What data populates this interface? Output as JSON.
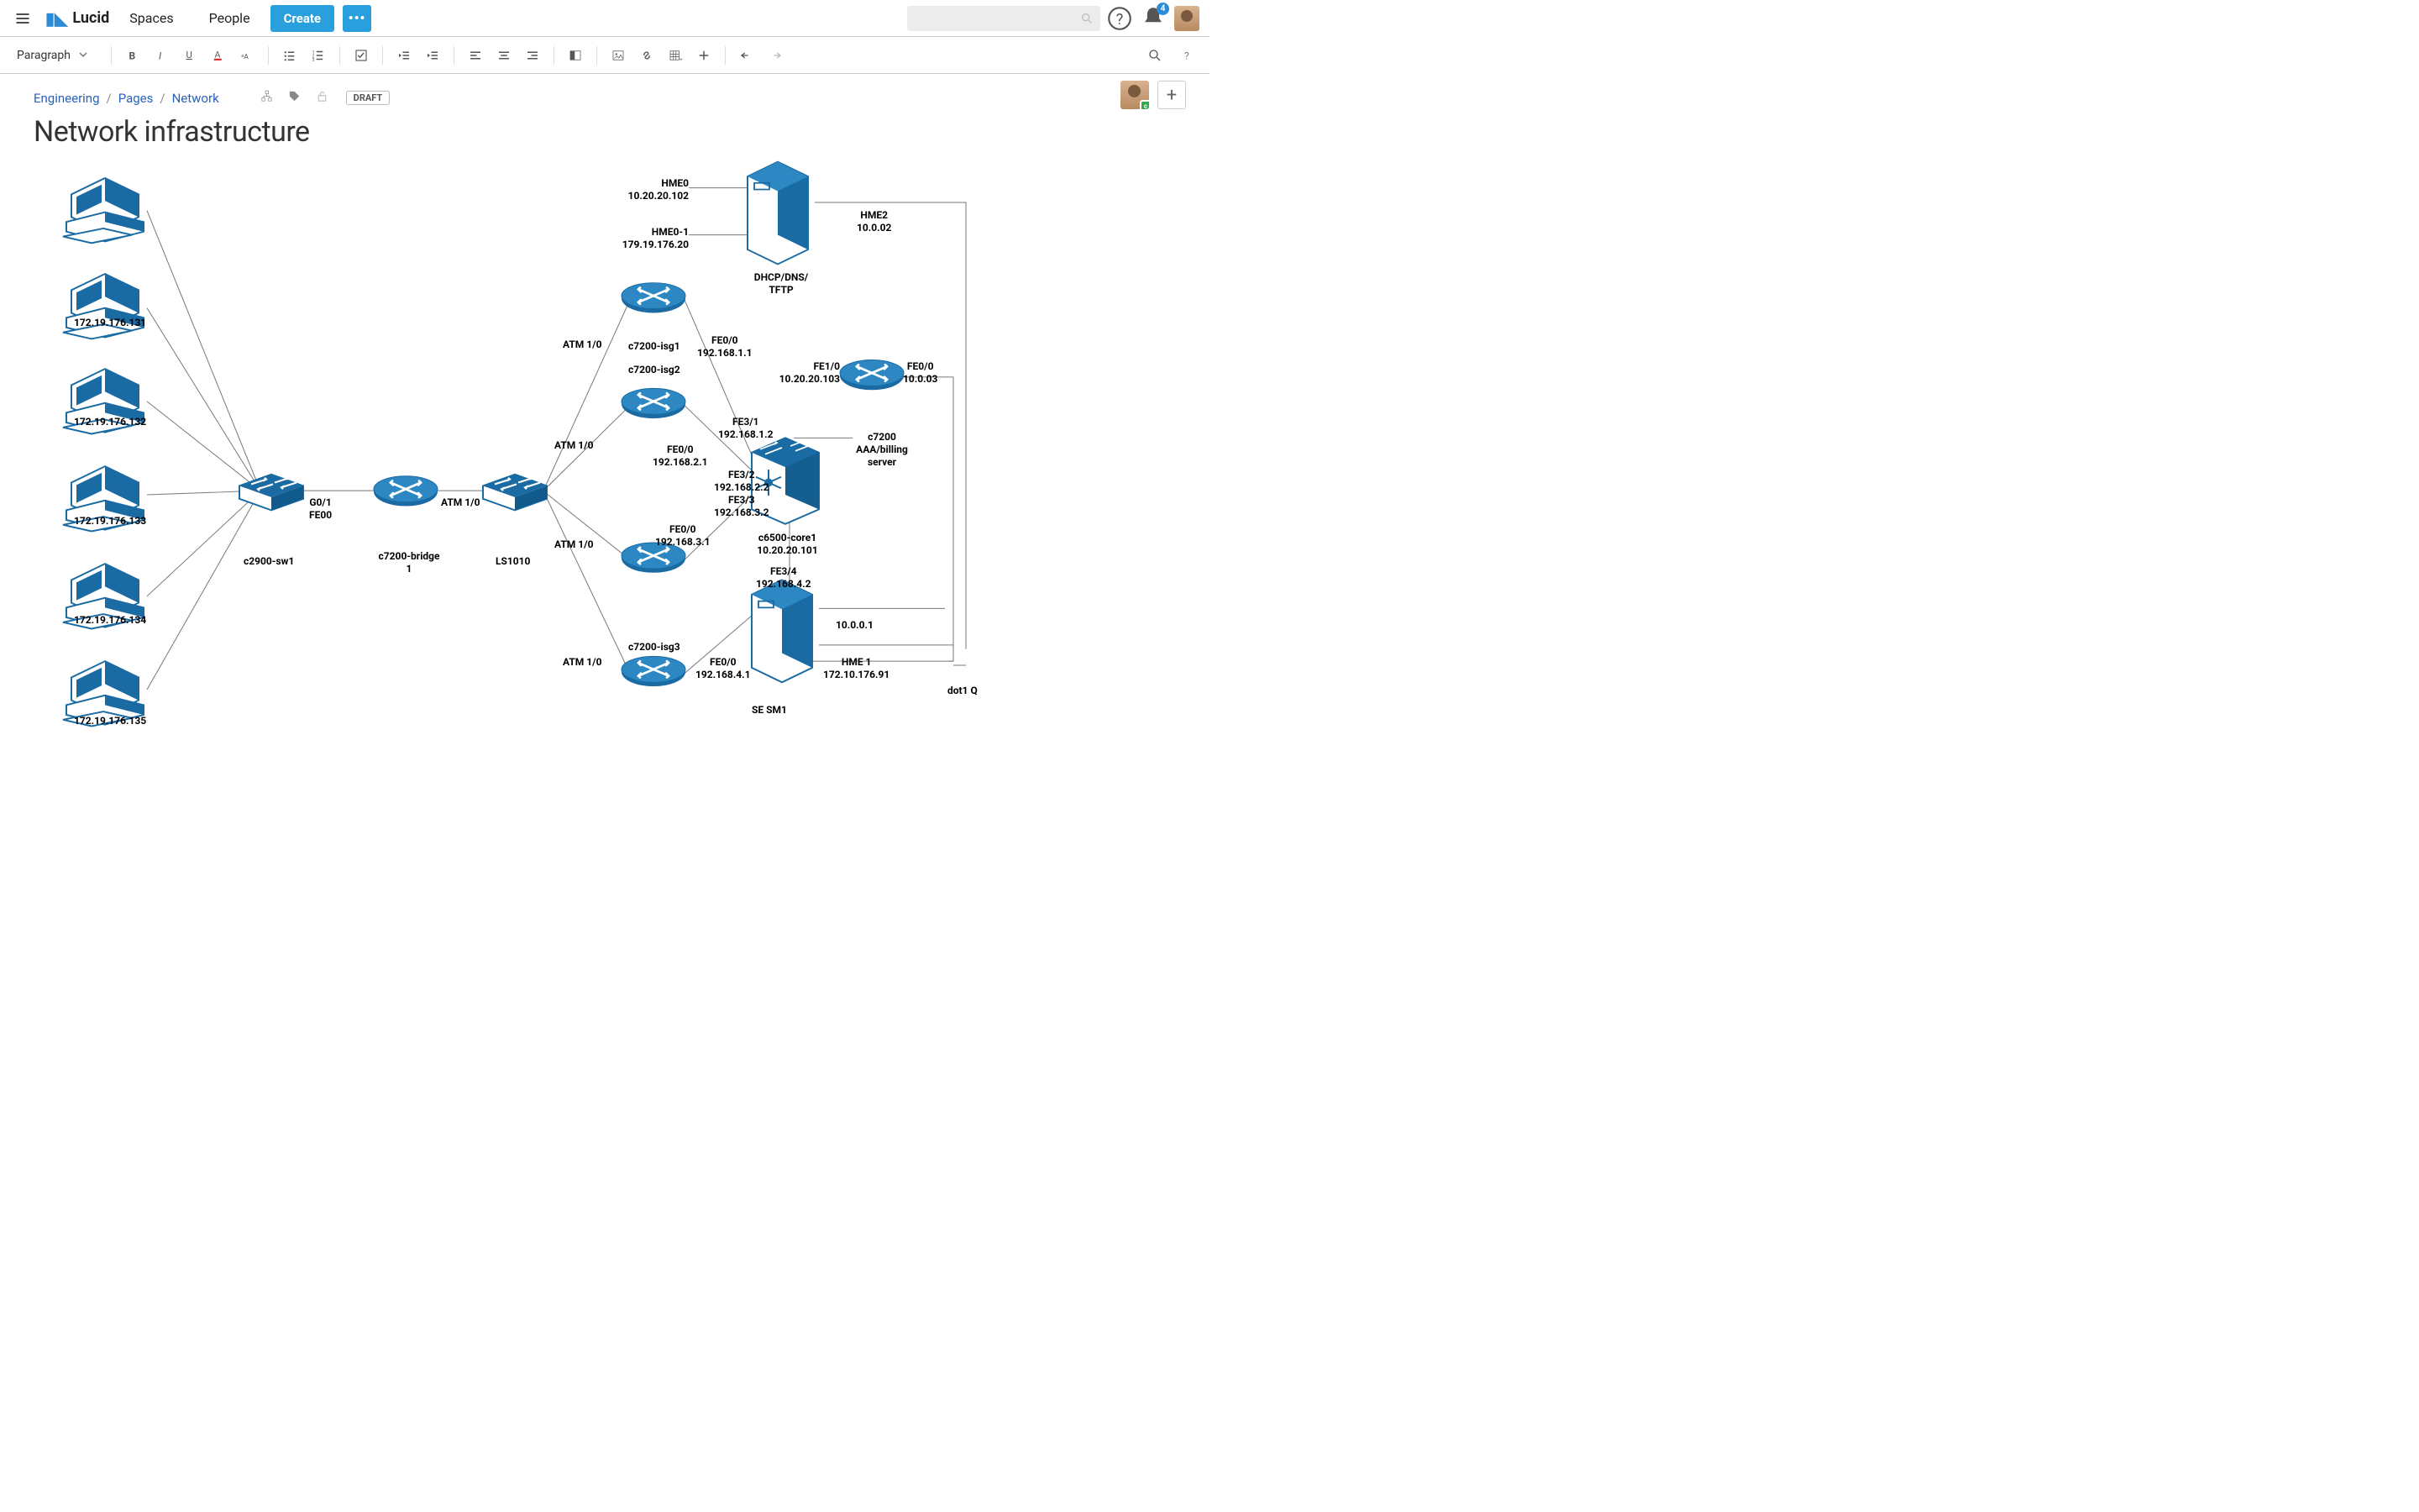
{
  "header": {
    "brand": "Lucid",
    "nav": {
      "spaces": "Spaces",
      "people": "People"
    },
    "create_label": "Create",
    "notification_count": "4"
  },
  "toolbar": {
    "paragraph_label": "Paragraph"
  },
  "page": {
    "breadcrumb": {
      "space": "Engineering",
      "parent": "Pages",
      "current": "Network"
    },
    "status_badge": "DRAFT",
    "title": "Network infrastructure"
  },
  "diagram": {
    "hosts": [
      {
        "ip": "172.19.176.131"
      },
      {
        "ip": "172.19.176.132"
      },
      {
        "ip": "172.19.176.133"
      },
      {
        "ip": "172.19.176.134"
      },
      {
        "ip": "172.19.176.135"
      }
    ],
    "c2900_label": "c2900-sw1",
    "bridge_label": "c7200-bridge\n1",
    "bridge_left_port": "G0/1\nFE00",
    "bridge_right_port": "ATM 1/0",
    "ls1010_label": "LS1010",
    "atm_ports": [
      "ATM 1/0",
      "ATM 1/0",
      "ATM 1/0",
      "ATM 1/0"
    ],
    "isg_labels": {
      "top": "c7200-isg1",
      "mid": "c7200-isg2",
      "bot": "c7200-isg3"
    },
    "fe_ports": {
      "fe00_1": "FE0/0\n192.168.1.1",
      "fe31": "FE3/1\n192.168.1.2",
      "fe00_2": "FE0/0\n192.168.2.1",
      "fe32": "FE3/2\n192.168.2.2",
      "fe33": "FE3/3\n192.168.3.2",
      "fe00_3": "FE0/0\n192.168.3.1",
      "fe00_4": "FE0/0\n192.168.4.1",
      "fe34": "FE3/4\n192.168.4.2"
    },
    "core_label": "c6500-core1\n10.20.20.101",
    "server1": {
      "label": "DHCP/DNS/\nTFTP",
      "hme0": "HME0\n10.20.20.102",
      "hme01": "HME0-1\n179.19.176.20",
      "hme2": "HME2\n10.0.02"
    },
    "aaa": {
      "label": "c7200\nAAA/billing\nserver",
      "fe10": "FE1/0\n10.20.20.103",
      "fe00": "FE0/0\n10.0.03"
    },
    "sesm": {
      "label": "SE SM1",
      "hme1": "HME 1\n172.10.176.91",
      "ip": "10.0.0.1"
    },
    "dot1q": "dot1 Q"
  }
}
